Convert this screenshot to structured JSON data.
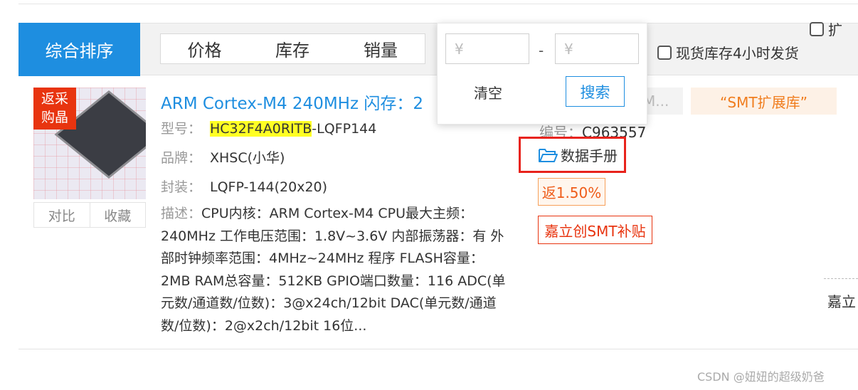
{
  "sort_bar": {
    "active_label": "综合排序",
    "buttons": [
      "价格",
      "库存",
      "销量"
    ],
    "checkbox_label": "现货库存4小时发货",
    "checkbox2_label": "扩"
  },
  "price_filter": {
    "min_placeholder": "¥",
    "max_placeholder": "¥",
    "dash": "-",
    "clear_label": "清空",
    "search_label": "搜索"
  },
  "product": {
    "rebate_badge_line1": "返采",
    "rebate_badge_line2": "购晶",
    "compare_label": "对比",
    "favorite_label": "收藏",
    "title": "ARM Cortex-M4 240MHz 闪存：2",
    "model_key": "型号：",
    "model_highlight": "HC32F4A0RITB",
    "model_suffix": "-LQFP144",
    "brand_key": "品牌：",
    "brand_value": "XHSC(小华)",
    "package_key": "封装：",
    "package_value": "LQFP-144(20x20)",
    "desc_key": "描述：",
    "desc_value": "CPU内核：ARM Cortex-M4 CPU最大主频：240MHz 工作电压范围：1.8V~3.6V 内部振荡器：有 外部时钟频率范围：4MHz~24MHz 程序 FLASH容量：2MB RAM总容量：512KB GPIO端口数量：116 ADC(单元数/通道数/位数)：3@x24ch/12bit DAC(单元数/通道数/位数)：2@x2ch/12bit 16位...",
    "gray_tag": "M...",
    "smt_tag": "“SMT扩展库”",
    "code_key": "编号：",
    "code_value": "C963557",
    "datasheet_label": "数据手册",
    "rebate_tag": "返1.50%",
    "subsidy_tag": "嘉立创SMT补贴",
    "side_text": "嘉立"
  },
  "watermark": "CSDN @妞妞的超级奶爸"
}
